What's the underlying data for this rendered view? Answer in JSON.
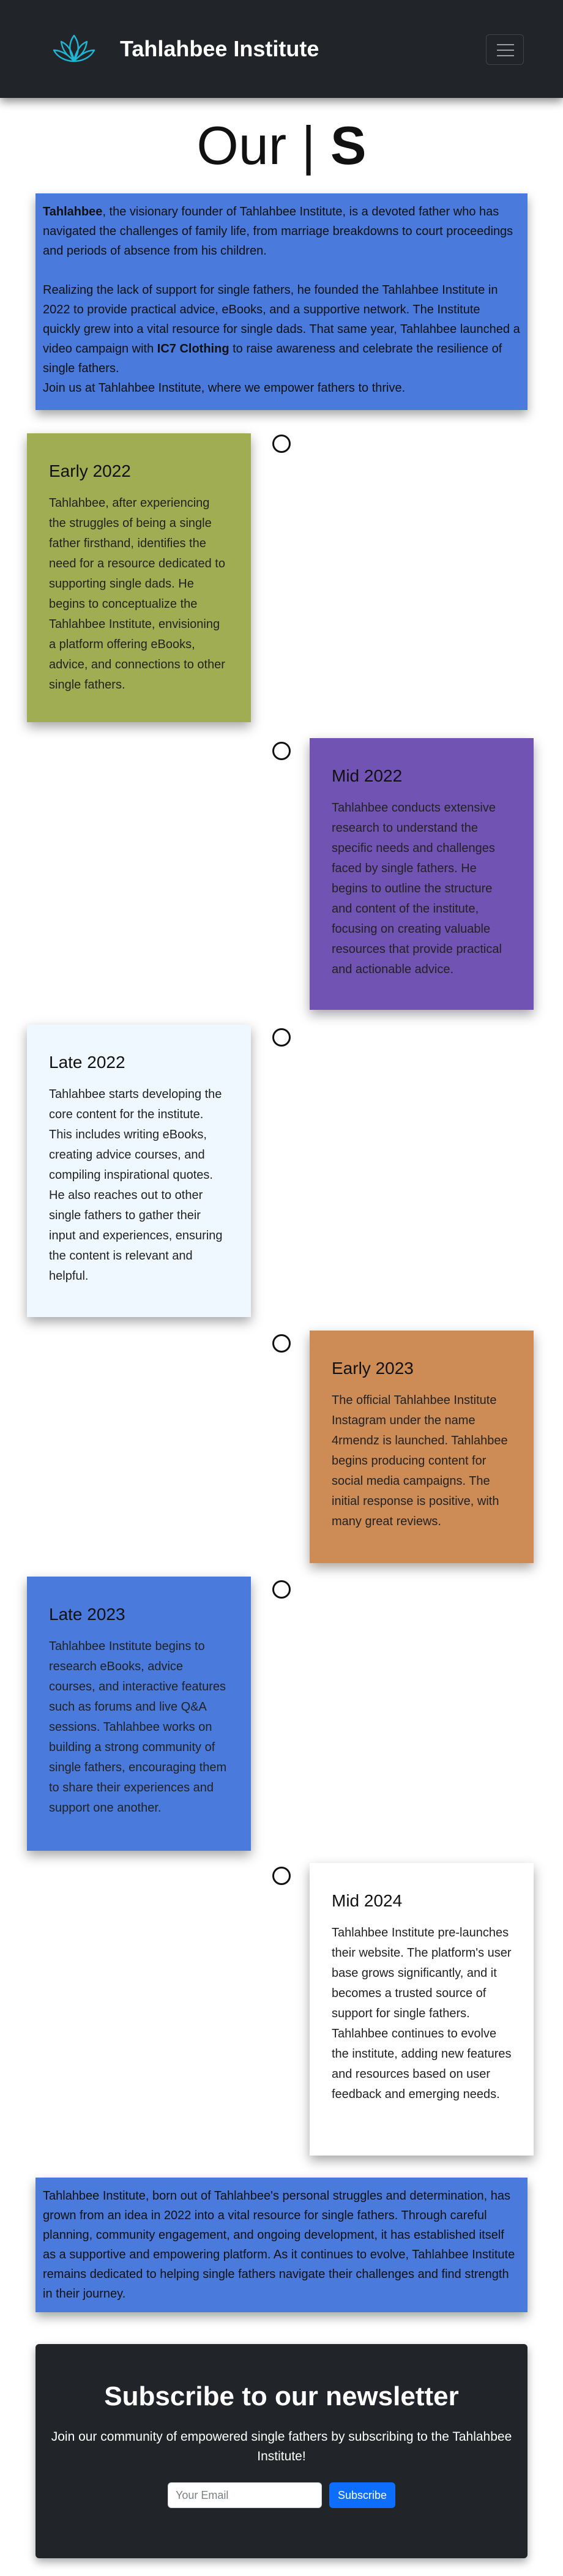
{
  "nav": {
    "brand": "Tahlahbee Institute",
    "logo_icon": "lotus-icon",
    "menu_icon": "hamburger-menu-icon"
  },
  "title": {
    "part1": "Our | ",
    "part2": "S"
  },
  "intro": {
    "name": "Tahlahbee",
    "p1_rest": ", the visionary founder of Tahlahbee Institute, is a devoted father who has navigated the challenges of family life, from marriage breakdowns to court proceedings and periods of absence from his children.",
    "p2_pre": "Realizing the lack of support for single fathers, he founded the Tahlahbee Institute in 2022 to provide practical advice, eBooks, and a supportive network. The Institute quickly grew into a vital resource for single dads. That same year, Tahlahbee launched a video campaign with ",
    "p2_brand": "IC7 Clothing",
    "p2_post": " to raise awareness and celebrate the resilience of single fathers.",
    "p3": "Join us at Tahlahbee Institute, where we empower fathers to thrive."
  },
  "timeline": [
    {
      "title": "Early 2022",
      "text": "Tahlahbee, after experiencing the struggles of being a single father firsthand, identifies the need for a resource dedicated to supporting single dads. He begins to conceptualize the Tahlahbee Institute, envisioning a platform offering eBooks, advice, and connections to other single fathers.",
      "color": "#a0ad52"
    },
    {
      "title": "Mid 2022",
      "text": "Tahlahbee conducts extensive research to understand the specific needs and challenges faced by single fathers. He begins to outline the structure and content of the institute, focusing on creating valuable resources that provide practical and actionable advice.",
      "color": "#7153b3"
    },
    {
      "title": "Late 2022",
      "text": "Tahlahbee starts developing the core content for the institute. This includes writing eBooks, creating advice courses, and compiling inspirational quotes. He also reaches out to other single fathers to gather their input and experiences, ensuring the content is relevant and helpful.",
      "color": "#f0f8ff"
    },
    {
      "title": "Early 2023",
      "text": "The official Tahlahbee Institute Instagram under the name 4rmendz is launched. Tahlahbee begins producing content for social media campaigns. The initial response is positive, with many great reviews.",
      "color": "#cd8b55"
    },
    {
      "title": "Late 2023",
      "text": "Tahlahbee Institute begins to research eBooks, advice courses, and interactive features such as forums and live Q&A sessions. Tahlahbee works on building a strong community of single fathers, encouraging them to share their experiences and support one another.",
      "color": "#4a7bdc"
    },
    {
      "title": "Mid 2024",
      "text": "Tahlahbee Institute pre-launches their website. The platform's user base grows significantly, and it becomes a trusted source of support for single fathers. Tahlahbee continues to evolve the institute, adding new features and resources based on user feedback and emerging needs.",
      "color": "#ffffff"
    }
  ],
  "outro": {
    "text": "Tahlahbee Institute, born out of Tahlahbee's personal struggles and determination, has grown from an idea in 2022 into a vital resource for single fathers. Through careful planning, community engagement, and ongoing development, it has established itself as a supportive and empowering platform. As it continues to evolve, Tahlahbee Institute remains dedicated to helping single fathers navigate their challenges and find strength in their journey."
  },
  "newsletter": {
    "heading": "Subscribe to our newsletter",
    "text": "Join our community of empowered single fathers by subscribing to the Tahlahbee Institute!",
    "placeholder": "Your Email",
    "button": "Subscribe"
  }
}
